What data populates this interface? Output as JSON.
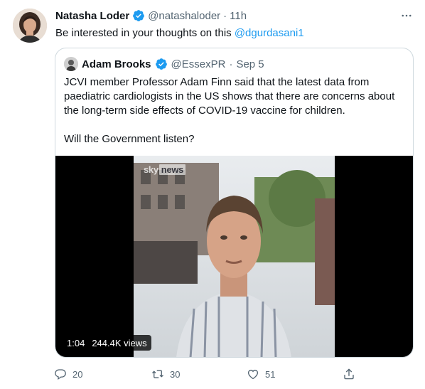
{
  "tweet": {
    "author_name": "Natasha Loder",
    "author_handle": "@natashaloder",
    "separator": "·",
    "time": "11h",
    "text": "Be interested in your thoughts on this ",
    "mention": "@dgurdasani1"
  },
  "quote": {
    "author_name": "Adam Brooks",
    "author_handle": "@EssexPR",
    "separator": "·",
    "date": "Sep 5",
    "paragraph1": "JCVI member Professor Adam Finn said that the latest data from paediatric cardiologists in the US shows that there are concerns about the long-term side effects of COVID-19 vaccine for children.",
    "paragraph2": "Will the Government listen?",
    "video": {
      "logo_sky": "sky",
      "logo_news": "news",
      "duration": "1:04",
      "views": "244.4K views"
    }
  },
  "actions": {
    "reply_count": "20",
    "retweet_count": "30",
    "like_count": "51"
  },
  "colors": {
    "accent": "#1d9bf0",
    "secondary_text": "#536471",
    "border": "#cfd9de"
  },
  "icons": [
    "verified-badge-icon",
    "more-icon",
    "reply-icon",
    "retweet-icon",
    "like-icon",
    "share-icon"
  ]
}
